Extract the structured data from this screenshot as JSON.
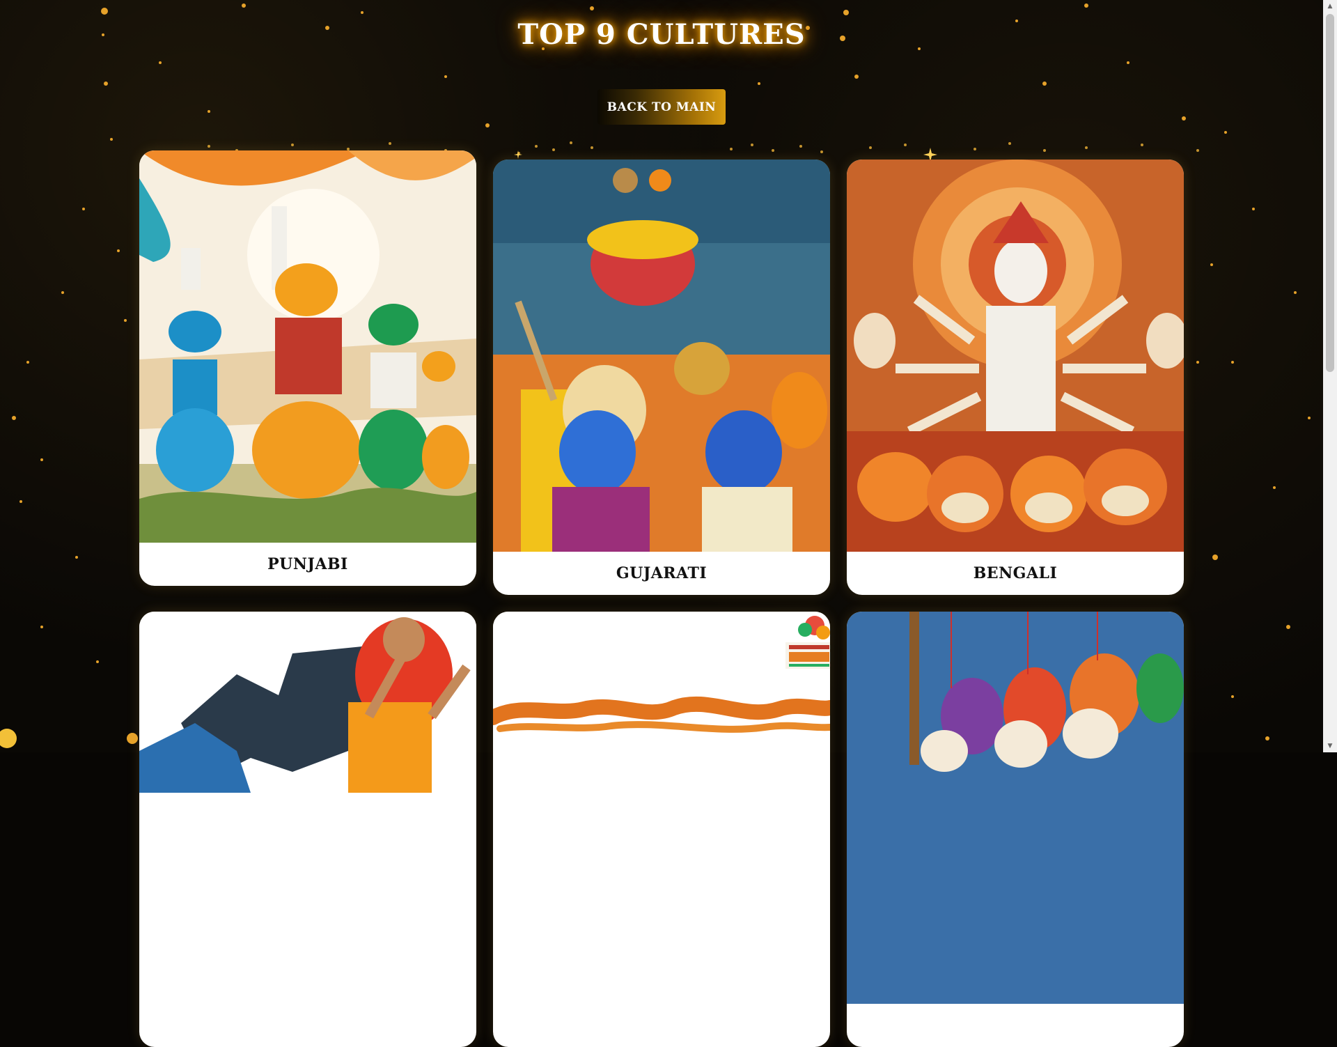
{
  "header": {
    "title": "TOP 9 CULTURES"
  },
  "actions": {
    "back_label": "BACK TO MAIN"
  },
  "cards": [
    {
      "name": "PUNJABI"
    },
    {
      "name": "GUJARATI"
    },
    {
      "name": "BENGALI"
    }
  ],
  "colors": {
    "accent": "#d89c10",
    "glow": "#ffb000",
    "background": "#080604",
    "card": "#ffffff"
  }
}
